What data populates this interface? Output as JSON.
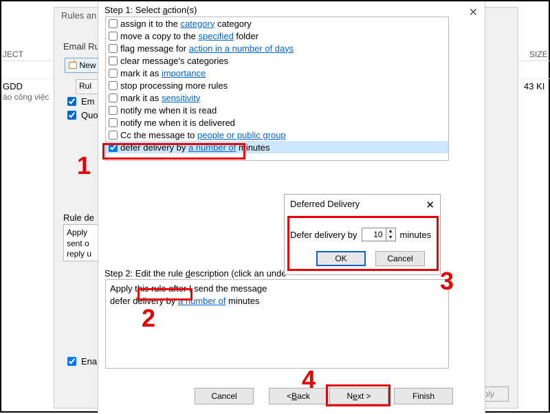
{
  "background": {
    "col_ject": "JECT",
    "col_size": "SIZE",
    "row1_a": "GDD",
    "row1_b": "áo công việc",
    "row1_size": "43 KI"
  },
  "rules_window": {
    "title": "Rules an",
    "section": "Email Ru",
    "new": "New",
    "rul_hdr": "Rul",
    "item_em": "Em",
    "item_quo": "Quo",
    "rule_de": "Rule de",
    "desc_l1": "Apply",
    "desc_l2": "sent o",
    "desc_l3": "reply u",
    "enable": "Enab",
    "apply": "Apply"
  },
  "wizard": {
    "step1": "Step 1: Select action(s)",
    "actions": [
      {
        "pre": "assign it to the ",
        "link": "category",
        "post": " category"
      },
      {
        "pre": "move a copy to the ",
        "link": "specified",
        "post": " folder"
      },
      {
        "pre": "flag message for ",
        "link": "action in a number of days",
        "post": ""
      },
      {
        "pre": "clear message's categories",
        "link": "",
        "post": ""
      },
      {
        "pre": "mark it as ",
        "link": "importance",
        "post": ""
      },
      {
        "pre": "stop processing more rules",
        "link": "",
        "post": ""
      },
      {
        "pre": "mark it as ",
        "link": "sensitivity",
        "post": ""
      },
      {
        "pre": "notify me when it is read",
        "link": "",
        "post": ""
      },
      {
        "pre": "notify me when it is delivered",
        "link": "",
        "post": ""
      },
      {
        "pre": "Cc the message to ",
        "link": "people or public group",
        "post": ""
      },
      {
        "pre": "defer delivery by ",
        "link": "a number of",
        "post": " minutes",
        "checked": true,
        "selected": true
      }
    ],
    "step2": "Step 2: Edit the rule description (click an unde",
    "desc_line1": "Apply this rule after I send the message",
    "desc_line2_pre": "defer delivery by ",
    "desc_line2_link": "a number of",
    "desc_line2_post": " minutes",
    "cancel": "Cancel",
    "back": "< Back",
    "next_pre": "N",
    "next_und": "e",
    "next_post": "xt >",
    "finish": "Finish"
  },
  "deferred": {
    "title": "Deferred Delivery",
    "label_pre": "Defer delivery by",
    "value": "10",
    "label_post": "minutes",
    "ok": "OK",
    "cancel": "Cancel"
  },
  "annotations": {
    "n1": "1",
    "n2": "2",
    "n3": "3",
    "n4": "4"
  }
}
